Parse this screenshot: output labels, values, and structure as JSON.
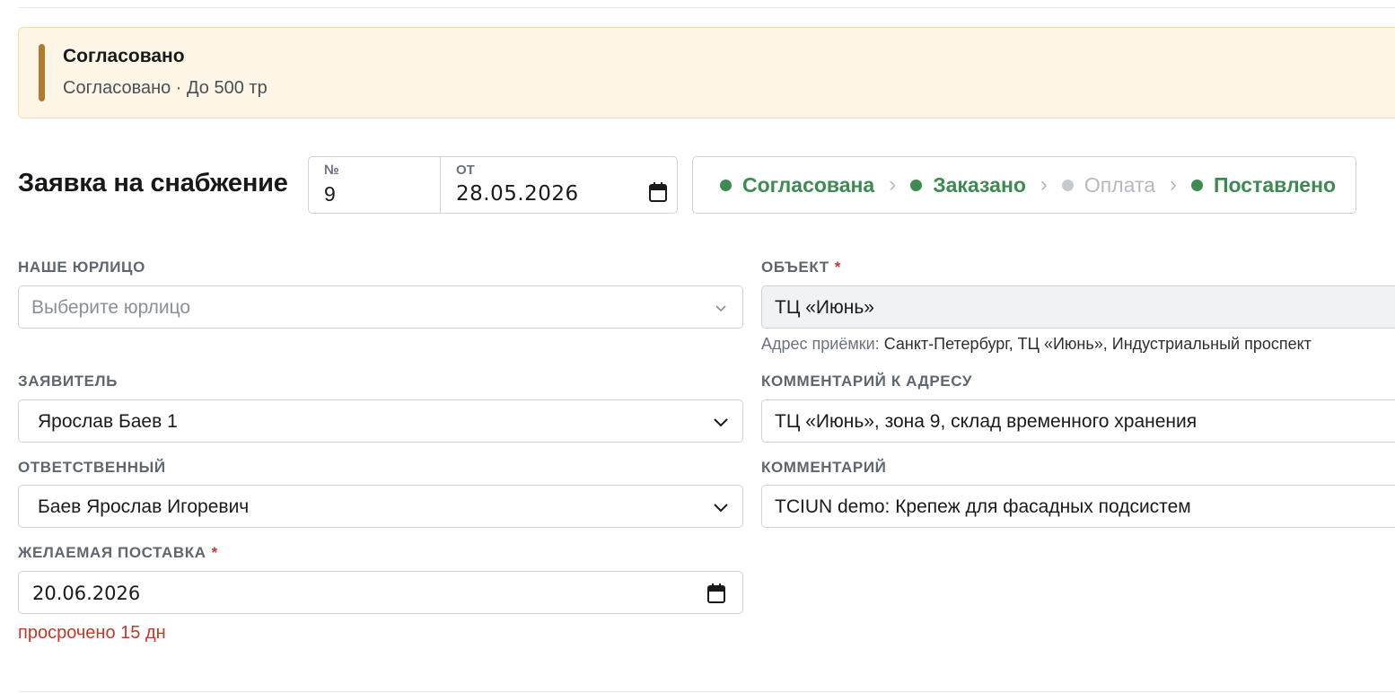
{
  "banner": {
    "title": "Согласовано",
    "subtitle": "Согласовано · До 500 тр",
    "accent_color": "#b17a2d",
    "background": "#fdf5e6"
  },
  "header": {
    "title": "Заявка на снабжение",
    "number_label": "№",
    "number_value": "9",
    "date_label": "ОТ",
    "date_value": "28.05.2026",
    "date_icon": "calendar-icon"
  },
  "stepper": {
    "steps": [
      {
        "label": "Согласована",
        "state": "done"
      },
      {
        "label": "Заказано",
        "state": "done"
      },
      {
        "label": "Оплата",
        "state": "pending"
      },
      {
        "label": "Поставлено",
        "state": "done"
      }
    ],
    "done_color": "#3d8a52",
    "pending_color": "#b4b9c0",
    "separator_icon": "chevron-right-icon"
  },
  "form": {
    "legal_entity": {
      "label": "НАШЕ ЮРЛИЦО",
      "placeholder": "Выберите юрлицо",
      "icon": "chevron-down-icon"
    },
    "object": {
      "label": "ОБЪЕКТ",
      "required_mark": "*",
      "value": "ТЦ «Июнь»",
      "address_label": "Адрес приёмки:",
      "address_value": "Санкт-Петербург, ТЦ «Июнь», Индустриальный проспект"
    },
    "applicant": {
      "label": "ЗАЯВИТЕЛЬ",
      "value": "Ярослав Баев 1",
      "icon": "chevron-down-icon"
    },
    "address_comment": {
      "label": "КОММЕНТАРИЙ К АДРЕСУ",
      "value": "ТЦ «Июнь», зона 9, склад временного хранения"
    },
    "responsible": {
      "label": "ОТВЕТСТВЕННЫЙ",
      "value": "Баев Ярослав Игоревич",
      "icon": "chevron-down-icon"
    },
    "comment": {
      "label": "КОММЕНТАРИЙ",
      "value": "TCIUN demo: Крепеж для фасадных подсистем"
    },
    "desired_delivery": {
      "label": "ЖЕЛАЕМАЯ ПОСТАВКА",
      "required_mark": "*",
      "value": "20.06.2026",
      "icon": "calendar-icon",
      "overdue_text": "просрочено 15 дн",
      "overdue_color": "#c0392b"
    }
  }
}
